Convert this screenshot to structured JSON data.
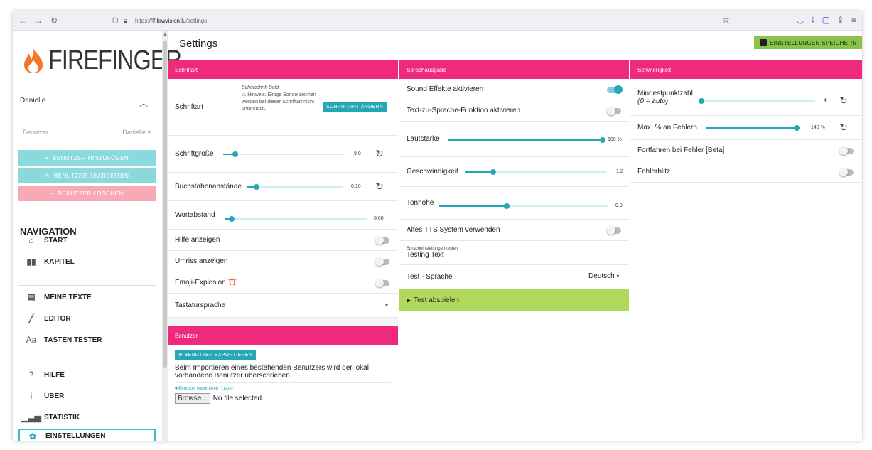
{
  "browser": {
    "url_prefix": "https://ff.",
    "url_domain": "lewvision.lu",
    "url_path": "/settings",
    "icons": [
      "back-icon",
      "forward-icon",
      "reload-icon",
      "shield-icon",
      "lock-icon",
      "star-icon",
      "pocket-icon",
      "download-icon",
      "extension-icon",
      "share-icon",
      "menu-icon"
    ]
  },
  "sidebar": {
    "logo_text": "FIREFINGER",
    "current_user": "Danielle",
    "user_select_label": "Benutzer",
    "user_select_value": "Danielle",
    "add_user": "BENUTZER HINZUFÜGEN",
    "edit_user": "BENUTZER BEARBEITEN",
    "delete_user": "BENUTZER LÖSCHEN",
    "nav_title": "NAVIGATION",
    "items": [
      {
        "label": "START",
        "icon": "home-icon"
      },
      {
        "label": "KAPITEL",
        "icon": "book-icon"
      },
      {
        "label": "MEINE TEXTE",
        "icon": "document-icon"
      },
      {
        "label": "EDITOR",
        "icon": "pencil-icon"
      },
      {
        "label": "TASTEN TESTER",
        "icon": "font-icon"
      },
      {
        "label": "HILFE",
        "icon": "question-icon"
      },
      {
        "label": "ÜBER",
        "icon": "info-icon"
      },
      {
        "label": "STATISTIK",
        "icon": "bar-chart-icon"
      },
      {
        "label": "EINSTELLUNGEN",
        "icon": "gear-icon"
      }
    ]
  },
  "main": {
    "title": "Settings",
    "save_label": "EINSTELLUNGEN SPEICHERN",
    "schriftart": {
      "header": "Schriftart",
      "font_label": "Schriftart",
      "font_name": "Schulschrift Bold",
      "hint": "⚠ Hinweis: Einige Sonderzeichen werden bei dieser Schriftart nicht unterstützt.",
      "change_font": "SCHRIFTART ÄNDERN",
      "size_label": "Schriftgröße",
      "size_value": "8.0",
      "size_level": 0.1,
      "spacing_label": "Buchstabenabstände",
      "spacing_value": "0.10",
      "spacing_level": 0.1,
      "word_label": "Wortabstand",
      "word_value": "0.00",
      "word_level": 0.05,
      "help_label": "Hilfe anzeigen",
      "outline_label": "Umriss anzeigen",
      "emoji_label": "Emoji-Explosion 💢",
      "keyboard_label": "Tastatursprache"
    },
    "benutzer": {
      "header": "Benutzer",
      "export_label": "BENUTZER EXPORTIEREN",
      "import_note": "Beim Importieren eines bestehenden Benutzers wird der lokal vorhandene Benutzer überschrieben.",
      "import_label": "Benutzer importieren (*.json)",
      "browse_label": "Browse...",
      "no_file": "No file selected."
    },
    "sprachausgabe": {
      "header": "Sprachausgabe",
      "sound_label": "Sound Effekte aktivieren",
      "tts_label": "Text-zu-Sprache-Funktion aktivieren",
      "volume_label": "Lautstärke",
      "volume_value": "100 %",
      "volume_level": 1.0,
      "speed_label": "Geschwindigkeit",
      "speed_value": "1.2",
      "speed_level": 0.2,
      "pitch_label": "Tonhöhe",
      "pitch_value": "0.9",
      "pitch_level": 0.4,
      "old_tts_label": "Altes TTS System verwenden",
      "test_caption": "Spracheinstellungen testen",
      "test_text": "Testing Text",
      "test_lang_label": "Test - Sprache",
      "test_lang_value": "Deutsch",
      "play_label": "Test abspielen"
    },
    "schwierigkeit": {
      "header": "Schwierigkeit",
      "min_points_label": "Mindestpunktzahl",
      "min_points_note": "(0 = auto)",
      "min_points_value": "4",
      "min_points_level": 0.0,
      "max_errors_label": "Max. % an Fehlern",
      "max_errors_value": "140 %",
      "max_errors_level": 1.0,
      "continue_label": "Fortfahren bei Fehler [Beta]",
      "flash_label": "Fehlerblitz"
    }
  }
}
